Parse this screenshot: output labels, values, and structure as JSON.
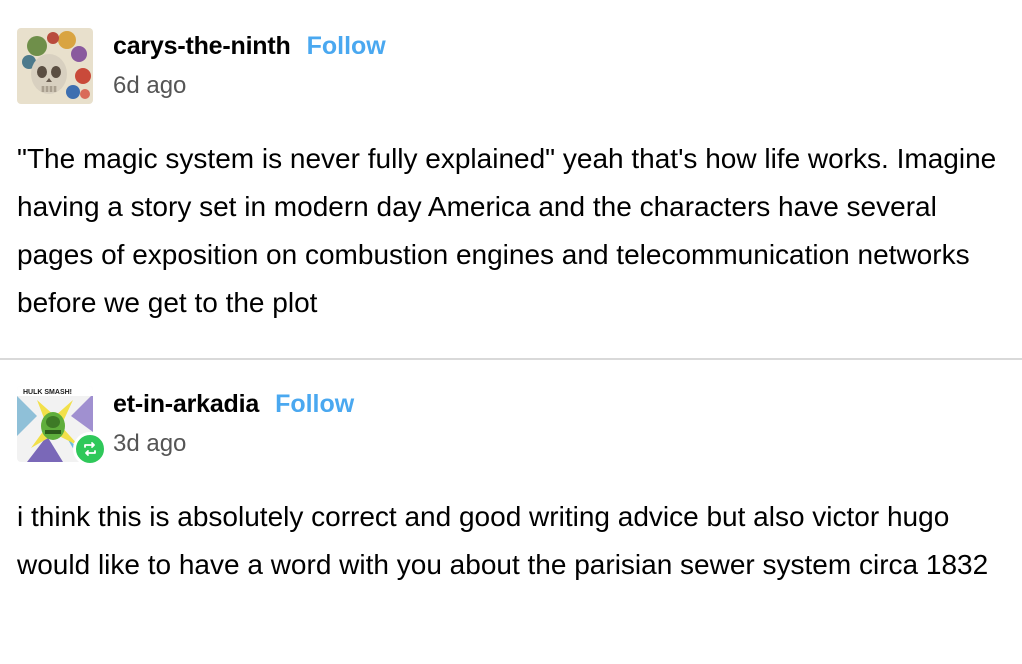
{
  "colors": {
    "follow": "#4aa8f0",
    "text": "#000000",
    "meta": "#555555",
    "divider": "#d9d9d9",
    "reblog_badge": "#2fc85a"
  },
  "posts": [
    {
      "username": "carys-the-ninth",
      "follow_label": "Follow",
      "timestamp": "6d ago",
      "avatar_icon": "skull-floral-avatar",
      "body": "\"The magic system is never fully explained\" yeah that's how life works. Imagine having a story set in modern day America and the characters have several pages of exposition on combustion engines and telecommunication networks before we get to the plot"
    },
    {
      "username": "et-in-arkadia",
      "follow_label": "Follow",
      "timestamp": "3d ago",
      "avatar_icon": "hulk-comic-avatar",
      "avatar_caption": "HULK SMASH!",
      "badge_icon": "reblog-icon",
      "body": "i think this is absolutely correct and good writing advice but also victor hugo would like to have a word with you about the parisian sewer system circa 1832"
    }
  ]
}
